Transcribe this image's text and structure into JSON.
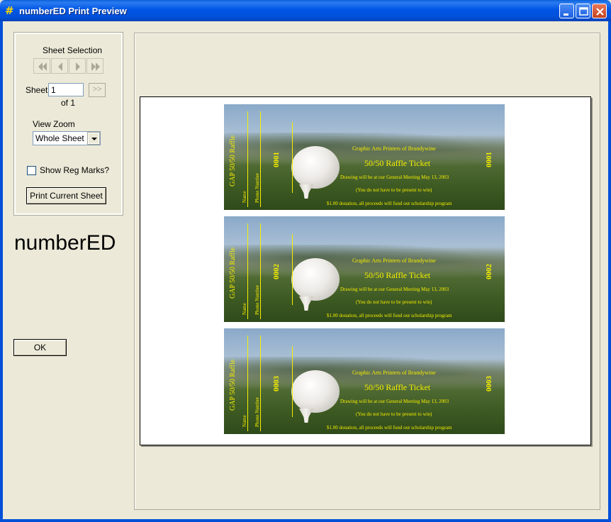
{
  "window": {
    "title": "numberED Print Preview",
    "app_icon_glyph": "#",
    "title_bar_color": "#0054e3"
  },
  "controls": {
    "sheet_selection_label": "Sheet Selection",
    "nav_buttons": [
      "first-sheet-icon",
      "prev-sheet-icon",
      "next-sheet-icon",
      "last-sheet-icon"
    ],
    "sheet_label": "Sheet",
    "sheet_value": "1",
    "go_button_label": ">>",
    "of_text": "of 1",
    "view_zoom_label": "View Zoom",
    "view_zoom_value": "Whole Sheet",
    "show_reg_marks_label": "Show Reg Marks?",
    "show_reg_marks_checked": false,
    "print_current_sheet_label": "Print Current Sheet"
  },
  "brand_text": "numberED",
  "ok_label": "OK",
  "ticket_text": {
    "stub_title": "GAP 50/50 Raffle",
    "name_label": "Name",
    "phone_label": "Phone Number",
    "org": "Graphic Arts Printers of Brandywine",
    "headline": "50/50 Raffle Ticket",
    "drawing": "Drawing will be at our General Meeting May 13, 2003",
    "presence": "(You do not have to be present to win)",
    "donation": "$1.00 donation, all proceeds will fund our scholarship program"
  },
  "tickets": [
    {
      "number": "0001"
    },
    {
      "number": "0002"
    },
    {
      "number": "0003"
    }
  ],
  "colors": {
    "ticket_text": "#f5ee00",
    "window_bg": "#ece9d8"
  }
}
